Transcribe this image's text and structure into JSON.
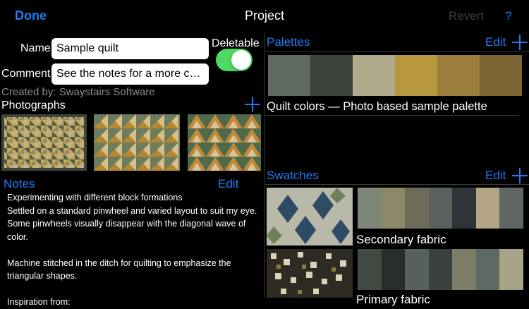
{
  "nav": {
    "done": "Done",
    "title": "Project",
    "revert": "Revert",
    "help": "?"
  },
  "form": {
    "name_label": "Name",
    "name_value": "Sample quilt",
    "deletable_label": "Deletable",
    "deletable_on": true,
    "comment_label": "Comment",
    "comment_value": "See the notes for a more co...",
    "created_by": "Created by: Swaystairs Software"
  },
  "photographs": {
    "title": "Photographs",
    "add_icon": "plus-icon"
  },
  "notes": {
    "title": "Notes",
    "edit": "Edit",
    "text": "Experimenting with different block formations\nSettled on a standard pinwheel and varied layout to suit my eye. Some pinwheels visually disappear with the diagonal wave of color.\n\nMachine stitched in the ditch for quilting to emphasize the triangular shapes.\n\nInspiration from:"
  },
  "palettes": {
    "title": "Palettes",
    "edit": "Edit",
    "items": [
      {
        "name": "Quilt colors — Photo based sample palette",
        "colors": [
          "#5f6a63",
          "#3b413b",
          "#b0aa8c",
          "#b8983e",
          "#9c7e3c",
          "#7a6432"
        ]
      }
    ]
  },
  "swatches": {
    "title": "Swatches",
    "edit": "Edit",
    "items": [
      {
        "name": "Secondary fabric",
        "colors": [
          "#7e8579",
          "#8c8a66",
          "#6c6a58",
          "#5a605b",
          "#2e3437",
          "#b4a584",
          "#5e6766"
        ]
      },
      {
        "name": "Primary fabric",
        "colors": [
          "#434a44",
          "#2a2e2a",
          "#56605d",
          "#3a413c",
          "#7d7d68",
          "#5d6963",
          "#a8a487"
        ]
      }
    ]
  }
}
